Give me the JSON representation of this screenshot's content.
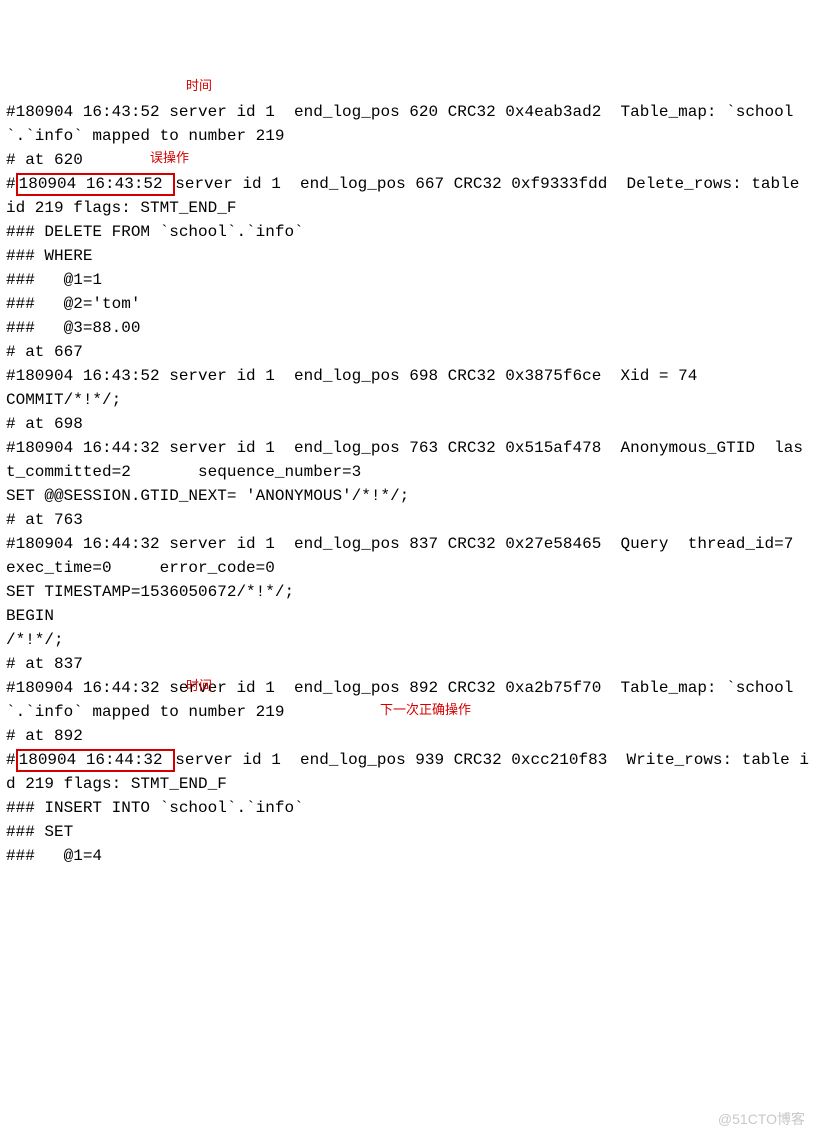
{
  "log": {
    "l01": "#180904 16:43:52 server id 1  end_log_pos 620 CRC32 0x4eab3ad2  Table_map: `school`.`info` mapped to number 219",
    "l02": "# at 620",
    "l03_prefix": "#",
    "l03_box": "180904 16:43:52 ",
    "l03_suffix": "server id 1  end_log_pos 667 CRC32 0xf9333fdd  Delete_rows: table id 219 flags: STMT_END_F",
    "l04": "### DELETE FROM `school`.`info`",
    "l05": "### WHERE",
    "l06": "###   @1=1",
    "l07": "###   @2='tom'",
    "l08": "###   @3=88.00",
    "l09": "# at 667",
    "l10": "#180904 16:43:52 server id 1  end_log_pos 698 CRC32 0x3875f6ce  Xid = 74",
    "l11": "COMMIT/*!*/;",
    "l12": "# at 698",
    "l13": "#180904 16:44:32 server id 1  end_log_pos 763 CRC32 0x515af478  Anonymous_GTID  last_committed=2       sequence_number=3",
    "l14": "SET @@SESSION.GTID_NEXT= 'ANONYMOUS'/*!*/;",
    "l15": "# at 763",
    "l16": "#180904 16:44:32 server id 1  end_log_pos 837 CRC32 0x27e58465  Query  thread_id=7       exec_time=0     error_code=0",
    "l17": "SET TIMESTAMP=1536050672/*!*/;",
    "l18": "BEGIN",
    "l19": "/*!*/;",
    "l20": "# at 837",
    "l21": "#180904 16:44:32 server id 1  end_log_pos 892 CRC32 0xa2b75f70  Table_map: `school`.`info` mapped to number 219",
    "l22": "# at 892",
    "l23_prefix": "#",
    "l23_box": "180904 16:44:32 ",
    "l23_suffix": "server id 1  end_log_pos 939 CRC32 0xcc210f83  Write_rows: table id 219 flags: STMT_END_F",
    "l24": "### INSERT INTO `school`.`info`",
    "l25": "### SET",
    "l26": "###   @1=4"
  },
  "annotations": {
    "time1": "时间",
    "misop": "误操作",
    "time2": "时间",
    "nextop": "下一次正确操作"
  },
  "watermark": "@51CTO博客"
}
